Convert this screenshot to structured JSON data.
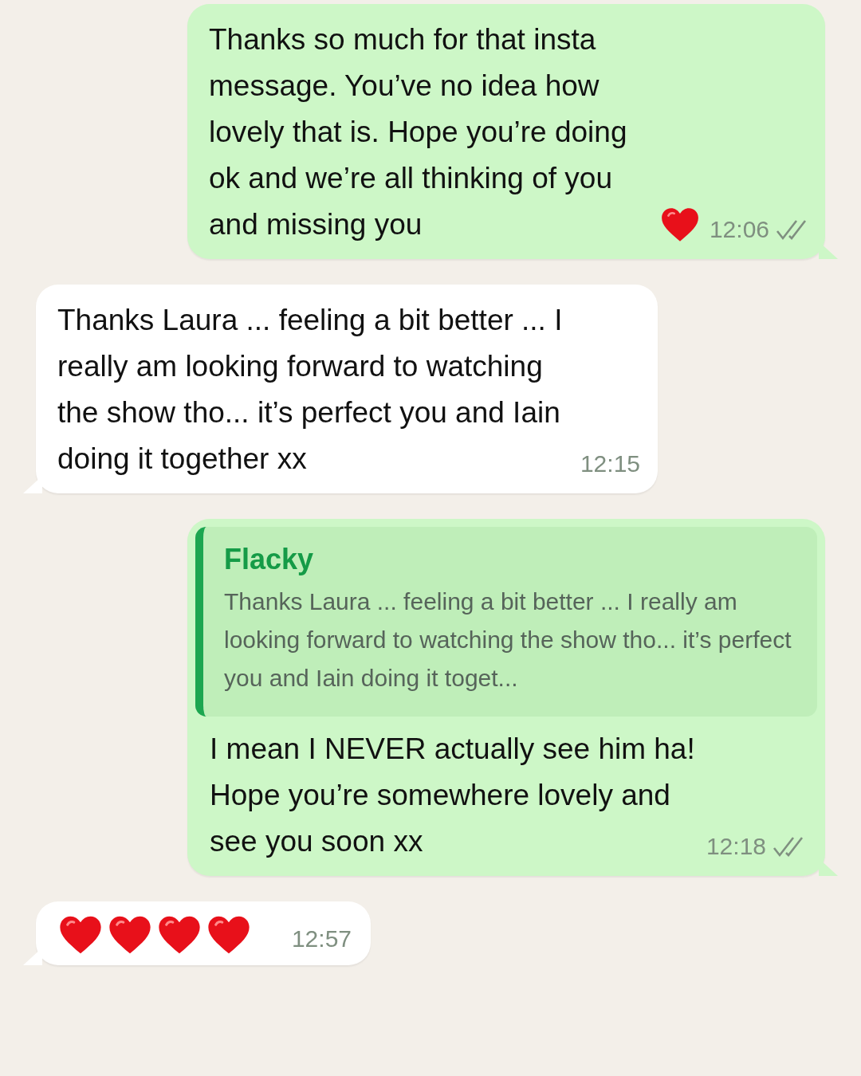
{
  "messages": [
    {
      "kind": "text",
      "outgoing": true,
      "text": "Thanks so much for that insta message. You’ve no idea how lovely that is. Hope you’re doing ok and we’re all thinking of you and missing you",
      "icons": [
        {
          "kind": "heart"
        }
      ],
      "time": "12:06",
      "delivered": true,
      "read": false
    },
    {
      "kind": "text",
      "outgoing": false,
      "text": "Thanks Laura ... feeling a bit better ... I really am looking forward to watching the show tho... it’s perfect you and Iain doing it together xx",
      "time": "12:15"
    },
    {
      "kind": "reply",
      "outgoing": true,
      "quote": {
        "author": "Flacky",
        "text": "Thanks Laura ... feeling a bit better ... I really am looking forward to watching the show tho... it’s perfect you and Iain doing it toget..."
      },
      "text": "I mean I NEVER actually see him ha! Hope you’re somewhere lovely and see you soon xx",
      "time": "12:18",
      "delivered": true,
      "read": false
    },
    {
      "kind": "icons",
      "outgoing": false,
      "icons": [
        {
          "kind": "heart"
        },
        {
          "kind": "heart"
        },
        {
          "kind": "heart"
        },
        {
          "kind": "heart"
        }
      ],
      "time": "12:57"
    }
  ]
}
